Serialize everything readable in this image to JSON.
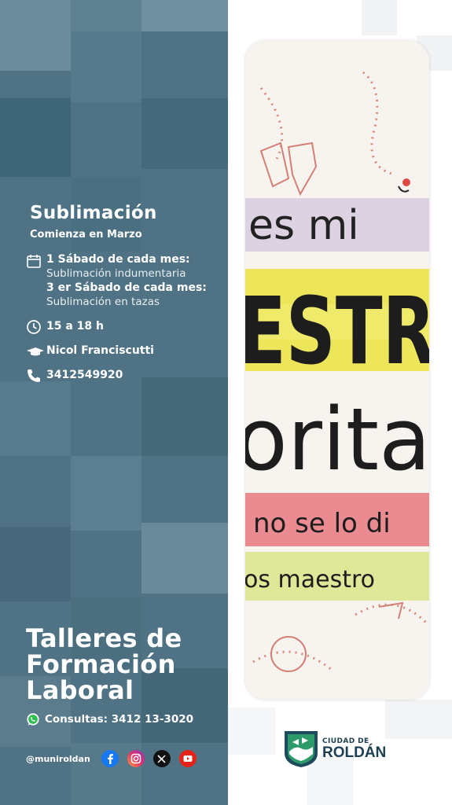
{
  "workshop": {
    "name": "Sublimación",
    "start": "Comienza en Marzo",
    "schedule_1_title": "1 Sábado de cada mes:",
    "schedule_1_detail": "Sublimación indumentaria",
    "schedule_2_title": "3 er Sábado de cada mes:",
    "schedule_2_detail": "Sublimación en tazas",
    "time": "15 a 18 h",
    "teacher": "Nicol Franciscutti",
    "phone": "3412549920"
  },
  "program": {
    "title_line1": "Talleres de",
    "title_line2": "Formación",
    "title_line3": "Laboral",
    "consultas": "Consultas: 3412 13-3020"
  },
  "social": {
    "handle": "@muniroldan",
    "icons": [
      "facebook-icon",
      "instagram-icon",
      "x-icon",
      "youtube-icon"
    ]
  },
  "mug_text": {
    "line1": "es mi",
    "line2": "ESTR",
    "line3": "orita",
    "line4": "no se lo di",
    "line5": "os maestro"
  },
  "logo": {
    "line1": "CIUDAD DE",
    "line2": "ROLDÁN"
  },
  "colors": {
    "panel": "#4f7385",
    "logo": "#1d3f52"
  }
}
